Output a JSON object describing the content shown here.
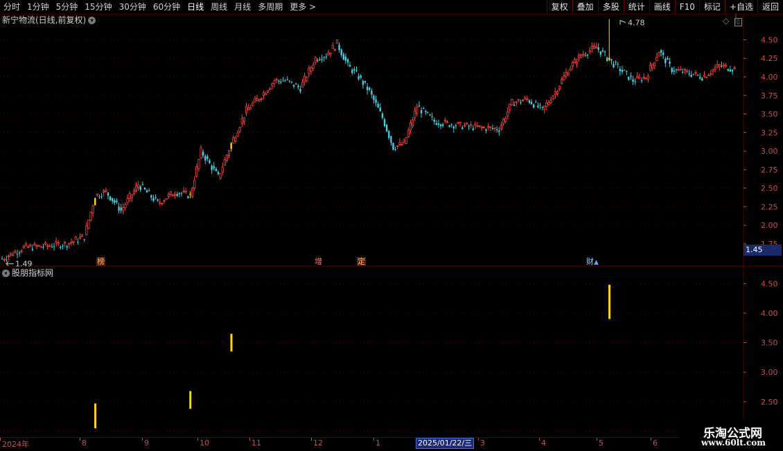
{
  "toolbar": {
    "periods": [
      "分时",
      "1分钟",
      "5分钟",
      "15分钟",
      "30分钟",
      "60分钟",
      "日线",
      "周线",
      "月线",
      "多周期",
      "更多 >"
    ],
    "active_period": "日线",
    "buttons": [
      "复权",
      "叠加",
      "多股",
      "统计",
      "画线",
      "F10",
      "标记",
      "+自选",
      "返回"
    ]
  },
  "main_panel": {
    "title": "新宁物流(日线,前复权)",
    "high_label": "4.78",
    "low_label": "1.49",
    "current_price": "1.45",
    "badges": {
      "bang": "榜",
      "zeng": "增",
      "ding": "定",
      "cai": "财"
    }
  },
  "indicator_panel": {
    "title": "股朋指标网"
  },
  "x_axis": {
    "labels": [
      "2024年",
      "8",
      "9",
      "10",
      "11",
      "12",
      "1",
      "3",
      "4",
      "5",
      "6"
    ],
    "selected_date": "2025/01/22/三"
  },
  "watermark": {
    "line1": "乐淘公式网",
    "line2": "www.60lt.com"
  },
  "colors": {
    "up": "#ff4040",
    "down": "#40d0e0",
    "signal": "#ffd800",
    "grid": "#5a0000",
    "axis_text": "#c85050"
  },
  "chart_data": [
    {
      "type": "candlestick",
      "title": "新宁物流(日线,前复权)",
      "y_ticks": [
        1.75,
        2.0,
        2.25,
        2.5,
        2.75,
        3.0,
        3.25,
        3.5,
        3.75,
        4.0,
        4.25,
        4.5
      ],
      "ylim": [
        1.45,
        4.85
      ],
      "x_months": [
        "2024年",
        "8",
        "9",
        "10",
        "11",
        "12",
        "1",
        "2",
        "3",
        "4",
        "5",
        "6"
      ],
      "signal_days": [
        "8月中",
        "10月初",
        "11月初",
        "5月中"
      ],
      "annotations": [
        {
          "text": "4.78",
          "kind": "high"
        },
        {
          "text": "1.49",
          "kind": "low"
        }
      ],
      "last_price": 1.45
    },
    {
      "type": "bar",
      "title": "股朋指标网",
      "y_ticks": [
        2.0,
        2.5,
        3.0,
        3.5,
        4.0,
        4.5
      ],
      "ylim": [
        1.9,
        4.75
      ],
      "series": [
        {
          "x": "2024-08",
          "low": 2.05,
          "high": 2.47
        },
        {
          "x": "2024-10",
          "low": 2.38,
          "high": 2.68
        },
        {
          "x": "2024-11",
          "low": 3.35,
          "high": 3.65
        },
        {
          "x": "2025-05",
          "low": 3.9,
          "high": 4.48
        }
      ]
    }
  ]
}
